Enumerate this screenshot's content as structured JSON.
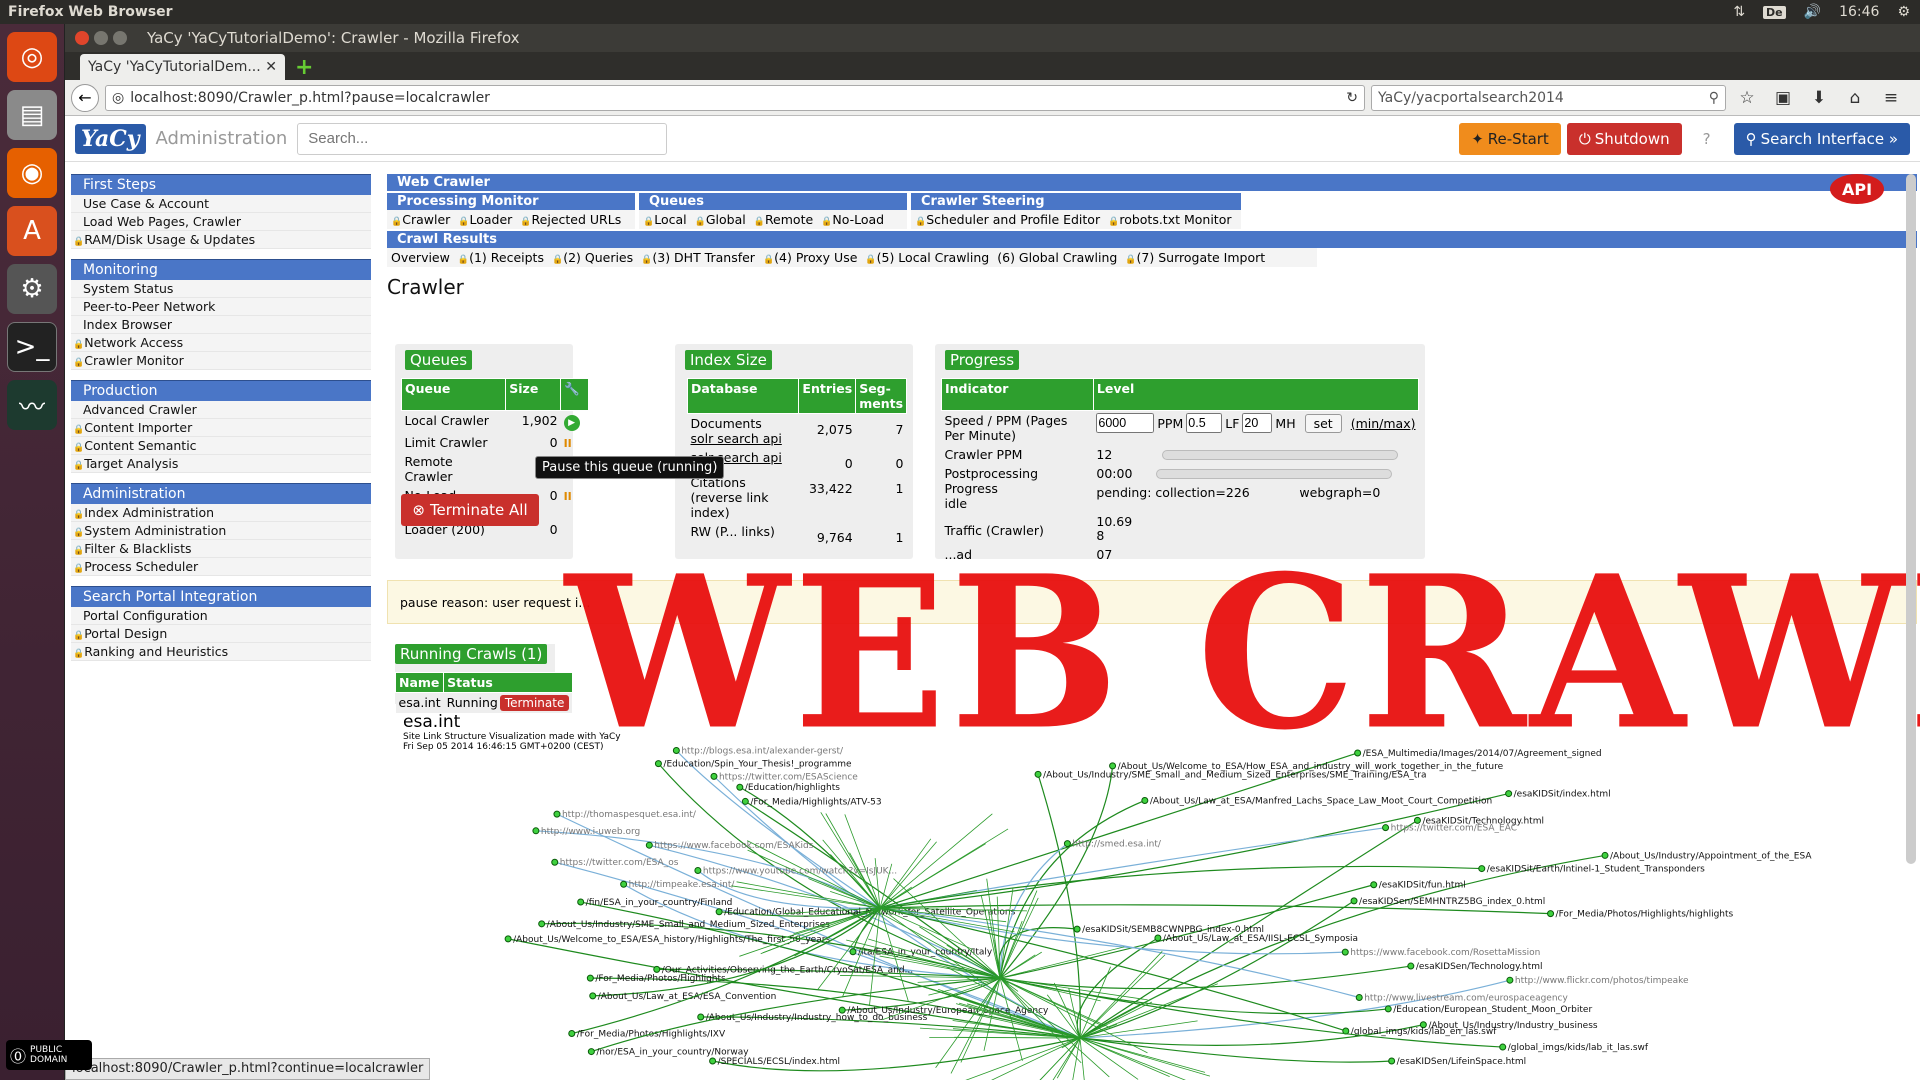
{
  "os": {
    "panel_title": "Firefox Web Browser",
    "keyboard_layout": "De",
    "clock": "16:46"
  },
  "window": {
    "title": "YaCy 'YaCyTutorialDemo': Crawler - Mozilla Firefox",
    "tab_title": "YaCy 'YaCyTutorialDem...",
    "url": "localhost:8090/Crawler_p.html?pause=localcrawler",
    "search_engine_text": "YaCy/yacportalsearch2014",
    "status_url": "localhost:8090/Crawler_p.html?continue=localcrawler"
  },
  "header": {
    "logo": "YaCy",
    "admin_label": "Administration",
    "search_placeholder": "Search...",
    "restart": "Re-Start",
    "shutdown": "Shutdown",
    "help": "?",
    "search_interface": "Search Interface »",
    "api": "API"
  },
  "sidebar": [
    {
      "title": "First Steps",
      "items": [
        "Use Case & Account",
        "Load Web Pages, Crawler",
        "RAM/Disk Usage & Updates"
      ]
    },
    {
      "title": "Monitoring",
      "items": [
        "System Status",
        "Peer-to-Peer Network",
        "Index Browser",
        "Network Access",
        "Crawler Monitor"
      ]
    },
    {
      "title": "Production",
      "items": [
        "Advanced Crawler",
        "Content Importer",
        "Content Semantic",
        "Target Analysis"
      ]
    },
    {
      "title": "Administration",
      "items": [
        "Index Administration",
        "System Administration",
        "Filter & Blacklists",
        "Process Scheduler"
      ]
    },
    {
      "title": "Search Portal Integration",
      "items": [
        "Portal Configuration",
        "Portal Design",
        "Ranking and Heuristics"
      ]
    }
  ],
  "topnav": {
    "web_crawler": "Web Crawler",
    "processing_monitor": "Processing Monitor",
    "queues": "Queues",
    "crawler_steering": "Crawler Steering",
    "processing_items": [
      "Crawler",
      "Loader",
      "Rejected URLs"
    ],
    "queue_items": [
      "Local",
      "Global",
      "Remote",
      "No-Load"
    ],
    "steering_items": [
      "Scheduler and Profile Editor",
      "robots.txt Monitor"
    ],
    "crawl_results": "Crawl Results",
    "result_items": [
      "Overview",
      "(1) Receipts",
      "(2) Queries",
      "(3) DHT Transfer",
      "(4) Proxy Use",
      "(5) Local Crawling",
      "(6) Global Crawling",
      "(7) Surrogate Import"
    ]
  },
  "page_title": "Crawler",
  "queues": {
    "title": "Queues",
    "col_queue": "Queue",
    "col_size": "Size",
    "rows": [
      {
        "name": "Local Crawler",
        "size": "1,902"
      },
      {
        "name": "Limit Crawler",
        "size": "0"
      },
      {
        "name": "Remote Crawler",
        "size": "0"
      },
      {
        "name": "No-Load Crawler",
        "size": "0"
      },
      {
        "name": "Loader (200)",
        "size": "0"
      }
    ],
    "terminate_all": "Terminate All",
    "tooltip": "Pause this queue (running)"
  },
  "index_size": {
    "title": "Index Size",
    "col_db": "Database",
    "col_entries": "Entries",
    "col_segments": "Seg-ments",
    "rows": [
      {
        "name": "Documents",
        "link": "solr search api",
        "entries": "2,075",
        "segments": "7"
      },
      {
        "name": "",
        "link": "solr search api",
        "entries": "0",
        "segments": "0"
      },
      {
        "name": "Citations (reverse link index)",
        "link": "",
        "entries": "33,422",
        "segments": "1"
      },
      {
        "name": "RW (P... links)",
        "link": "",
        "entries": "9,764",
        "segments": "1"
      }
    ]
  },
  "progress": {
    "title": "Progress",
    "col_indicator": "Indicator",
    "col_level": "Level",
    "speed_label": "Speed / PPM (Pages Per Minute)",
    "speed_value": "6000",
    "ppm": "PPM",
    "lf_value": "0.5",
    "lf": "LF",
    "mh_value": "20",
    "mh": "MH",
    "set": "set",
    "minmax": "(min/max)",
    "crawler_ppm_label": "Crawler PPM",
    "crawler_ppm_value": "12",
    "postproc_label": "Postprocessing Progress",
    "postproc_time": "00:00",
    "idle": "idle",
    "pending": "pending:",
    "collection": "collection=226",
    "webgraph": "webgraph=0",
    "traffic_label": "Traffic (Crawler)",
    "traffic_vals": [
      "10.69",
      "8",
      "07"
    ],
    "load_label": "...ad"
  },
  "pause_reason": "pause reason: user request i...",
  "running_crawls": {
    "title": "Running Crawls (1)",
    "col_name": "Name",
    "col_status": "Status",
    "row_name": "esa.int",
    "row_status": "Running",
    "terminate": "Terminate"
  },
  "viz": {
    "host": "esa.int",
    "caption1": "Site Link Structure Visualization made with YaCy",
    "caption2": "Fri Sep 05 2014 16:46:15 GMT+0200 (CEST)",
    "labels": [
      "http://blogs.esa.int/alexander-gerst/",
      "/Education/Spin_Your_Thesis!_programme",
      "https://twitter.com/ESAScience",
      "/Education/highlights",
      "/For_Media/Highlights/ATV-53",
      "http://thomaspesquet.esa.int/",
      "http://www.i-uweb.org",
      "https://www.facebook.com/ESAKids",
      "https://twitter.com/ESA_os",
      "https://www.youtube.com/watch?v=IsJUK...",
      "http://timpeake.esa.int/",
      "/fin/ESA_in_your_country/Finland",
      "/Education/Global_Educational_Network_for_Satellite_Operations",
      "/About_Us/Industry/SME_Small_and_Medium_Sized_Enterprises",
      "/About_Us/Welcome_to_ESA/ESA_history/Highlights/The_first_50_years",
      "/ita/ESA_in_your_country/Italy",
      "/Our_Activities/Observing_the_Earth/CryoSat/ESA_and...",
      "/For_Media/Photos/Highlights",
      "/About_Us/Law_at_ESA/ESA_Convention",
      "/About_Us/Industry/European_Space_Agency",
      "/About_Us/Industry/Industry_how_to_do_business",
      "/For_Media/Photos/Highlights/IXV",
      "/nor/ESA_in_your_country/Norway",
      "/SPECIALS/ECSL/index.html",
      "/ESA_Multimedia/Images/2014/07/Agreement_signed",
      "/About_Us/Welcome_to_ESA/How_ESA_and_industry_will_work_together_in_the_future",
      "/About_Us/Industry/SME_Small_and_Medium_Sized_Enterprises/SME_Training/ESA_tra",
      "/esaKIDSit/index.html",
      "/About_Us/Law_at_ESA/Manfred_Lachs_Space_Law_Moot_Court_Competition",
      "/esaKIDSit/Technology.html",
      "https://twitter.com/ESA_EAC",
      "http://smed.esa.int/",
      "/About_Us/Industry/Appointment_of_the_ESA",
      "/esaKIDSit/Earth/Intinel-1_Student_Transponders",
      "/esaKIDSit/fun.html",
      "/esaKIDSen/SEMHNTRZ5BG_index_0.html",
      "/For_Media/Photos/Highlights/highlights",
      "/esaKIDSit/SEMB8CWNPBG_index-0.html",
      "/About_Us/Law_at_ESA/IISL-ECSL_Symposia",
      "https://www.facebook.com/RosettaMission",
      "/esaKIDSen/Technology.html",
      "http://www.flickr.com/photos/timpeake",
      "http://www.livestream.com/eurospaceagency",
      "/Education/European_Student_Moon_Orbiter",
      "/About_Us/Industry/Industry_business",
      "/global_imgs/kids/lab_en_las.swf",
      "/global_imgs/kids/lab_it_las.swf",
      "/esaKIDSen/LifeinSpace.html"
    ]
  },
  "overlay_text": "WEB CRAWLING",
  "cc_badge": "PUBLIC DOMAIN"
}
